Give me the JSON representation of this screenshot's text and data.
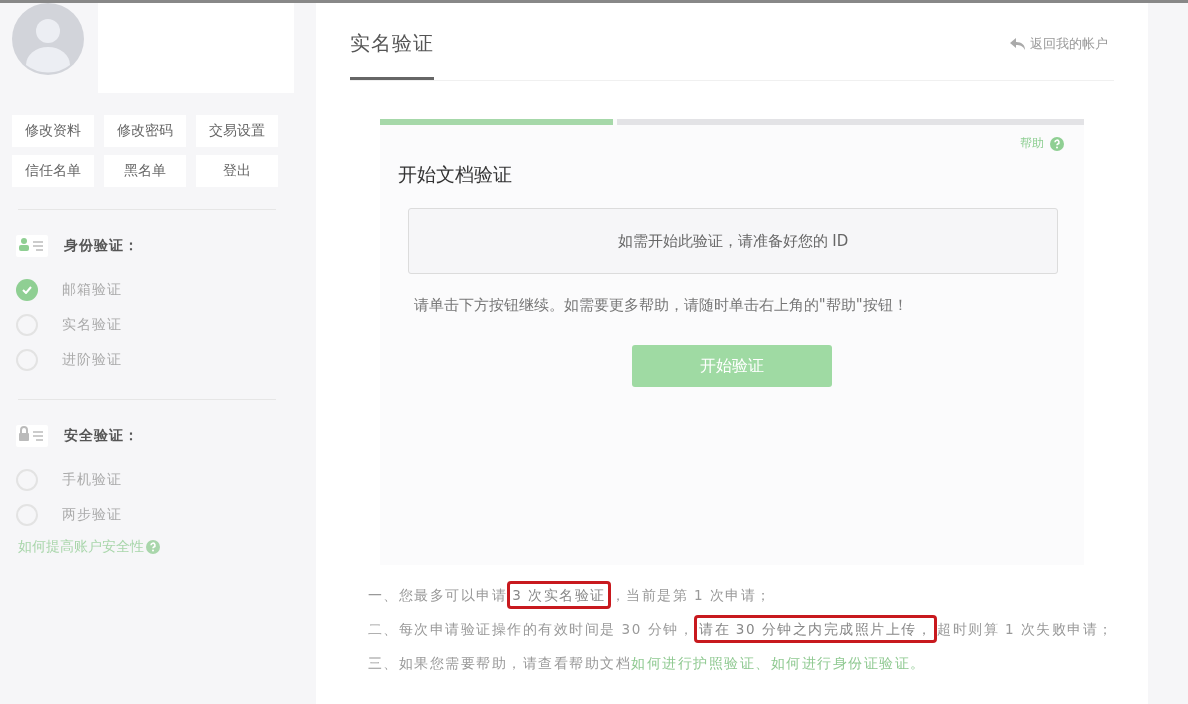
{
  "sidebar": {
    "actions": [
      {
        "label": "修改资料"
      },
      {
        "label": "修改密码"
      },
      {
        "label": "交易设置"
      },
      {
        "label": "信任名单"
      },
      {
        "label": "黑名单"
      },
      {
        "label": "登出"
      }
    ],
    "sections": [
      {
        "kind": "identity",
        "title": "身份验证：",
        "items": [
          {
            "label": "邮箱验证",
            "checked": true
          },
          {
            "label": "实名验证",
            "checked": false
          },
          {
            "label": "进阶验证",
            "checked": false
          }
        ]
      },
      {
        "kind": "security",
        "title": "安全验证：",
        "items": [
          {
            "label": "手机验证",
            "checked": false
          },
          {
            "label": "两步验证",
            "checked": false
          }
        ]
      }
    ],
    "help_link": "如何提高账户安全性"
  },
  "main": {
    "tab": "实名验证",
    "back_link": "返回我的帐户",
    "steps": [
      {
        "done": true
      },
      {
        "done": false
      }
    ],
    "help": "帮助",
    "heading": "开始文档验证",
    "notice": "如需开始此验证，请准备好您的 ID",
    "instruction": "请单击下方按钮继续。如需要更多帮助，请随时单击右上角的\"帮助\"按钮！",
    "start_button": "开始验证",
    "notes": [
      [
        {
          "kind": "plain",
          "text": "一、您最多可以申请"
        },
        {
          "kind": "boxed",
          "text": "3 次实名验证"
        },
        {
          "kind": "plain",
          "text": "，当前是第 1 次申请；"
        }
      ],
      [
        {
          "kind": "plain",
          "text": "二、每次申请验证操作的有效时间是 30 分钟，"
        },
        {
          "kind": "boxed",
          "text": "请在 30 分钟之内完成照片上传，"
        },
        {
          "kind": "plain",
          "text": "超时则算 1 次失败申请；"
        }
      ],
      [
        {
          "kind": "plain",
          "text": "三、如果您需要帮助，请查看帮助文档"
        },
        {
          "kind": "link",
          "text": "如何进行护照验证、如何进行身份证验证。"
        }
      ]
    ]
  }
}
